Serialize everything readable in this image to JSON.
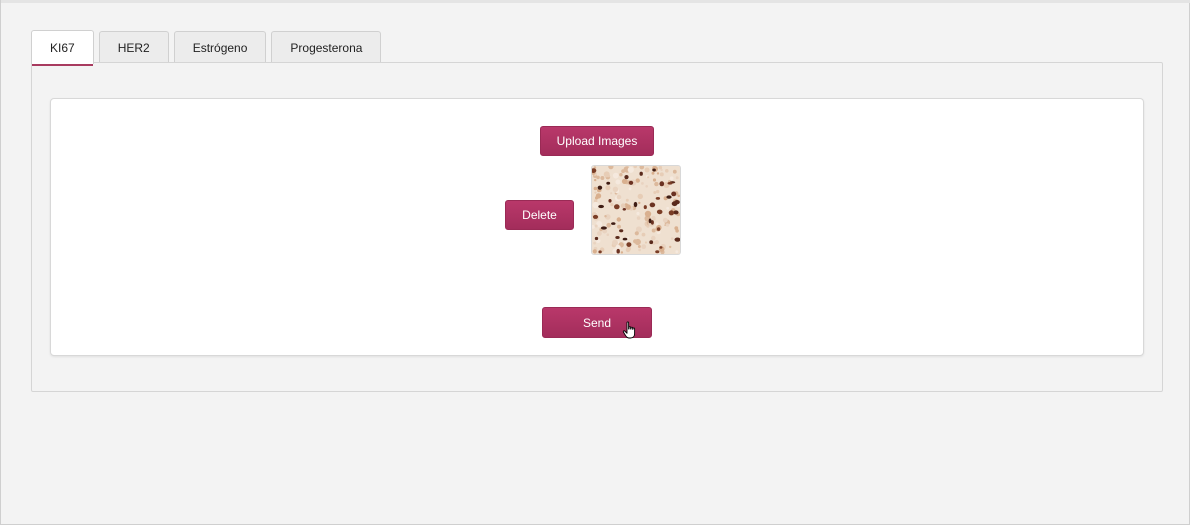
{
  "tabs": [
    {
      "label": "KI67",
      "active": true
    },
    {
      "label": "HER2",
      "active": false
    },
    {
      "label": "Estrógeno",
      "active": false
    },
    {
      "label": "Progesterona",
      "active": false
    }
  ],
  "panel": {
    "upload_label": "Upload Images",
    "delete_label": "Delete",
    "send_label": "Send",
    "thumbnail": {
      "icon": "histology-image-thumbnail"
    }
  },
  "colors": {
    "accent": "#a83b5f",
    "background": "#f3f3f3",
    "card": "#ffffff"
  }
}
